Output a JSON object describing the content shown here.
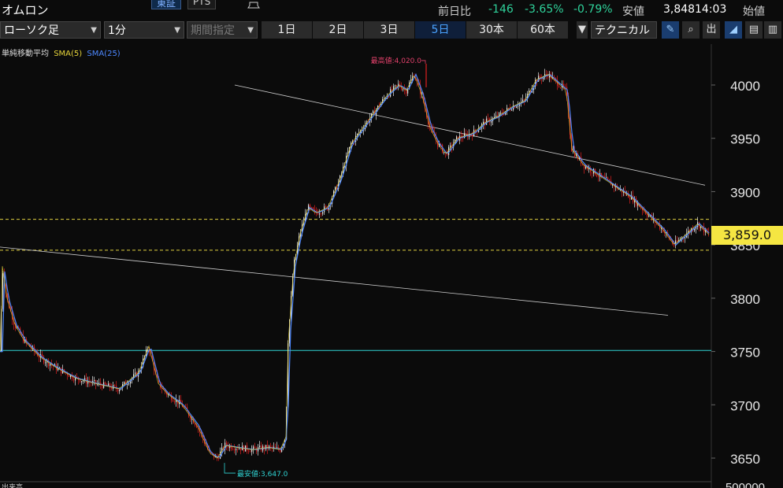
{
  "header": {
    "title": "オムロン",
    "exchange_tabs": [
      "東証",
      "PTS"
    ],
    "quote": {
      "prev_label": "前日比",
      "change": "-146",
      "change_pct": "-3.65%",
      "change_pct2": "-0.79%",
      "low_label": "安値",
      "low_value": "3,848",
      "time": "14:03",
      "open_label": "始値"
    }
  },
  "toolbar": {
    "chart_type": "ローソク足",
    "interval": "1分",
    "period": "期間指定",
    "timeframes": [
      "1日",
      "2日",
      "3日",
      "5日",
      "30本",
      "60本"
    ],
    "active_timeframe": "5日",
    "technical": "テクニカル"
  },
  "legend": {
    "title": "単純移動平均",
    "sma5": "SMA(5)",
    "sma25": "SMA(25)"
  },
  "chart_data": {
    "type": "line",
    "ylim": [
      3620,
      4060
    ],
    "y_ticks": [
      "4000",
      "3950",
      "3900",
      "3850",
      "3800",
      "3750",
      "3700",
      "3650"
    ],
    "last_price": "3,859.0",
    "high_label": "最高値:4,020.0",
    "low_label": "最安値:3,647.0",
    "volume_label": "500000",
    "vol_title": "出来高",
    "x": [
      0,
      2,
      8,
      18,
      30,
      50,
      70,
      95,
      120,
      150,
      175,
      188,
      200,
      212,
      230,
      250,
      265,
      275,
      285,
      300,
      320,
      340,
      355,
      362,
      365,
      372,
      380,
      390,
      400,
      415,
      430,
      445,
      460,
      475,
      490,
      505,
      515,
      525,
      535,
      545,
      555,
      565,
      580,
      600,
      615,
      630,
      650,
      665,
      680,
      695,
      710,
      718,
      725,
      740,
      760,
      780,
      800,
      820,
      840,
      855,
      870,
      885,
      900
    ],
    "values": [
      3750,
      3830,
      3800,
      3775,
      3760,
      3745,
      3735,
      3725,
      3720,
      3715,
      3730,
      3755,
      3720,
      3710,
      3700,
      3680,
      3655,
      3650,
      3662,
      3660,
      3658,
      3660,
      3658,
      3670,
      3760,
      3830,
      3860,
      3885,
      3880,
      3885,
      3910,
      3945,
      3960,
      3975,
      3990,
      4000,
      3995,
      4010,
      3990,
      3960,
      3945,
      3935,
      3950,
      3955,
      3965,
      3970,
      3980,
      3985,
      4005,
      4010,
      4000,
      3995,
      3940,
      3925,
      3915,
      3905,
      3895,
      3880,
      3865,
      3850,
      3860,
      3870,
      3859
    ],
    "high": {
      "x": 541,
      "value": 4020
    },
    "low": {
      "x": 285,
      "value": 3647
    },
    "hlines": [
      {
        "value": 3874,
        "color": "#e0d040",
        "style": "dash"
      },
      {
        "value": 3845,
        "color": "#e0d040",
        "style": "dash"
      },
      {
        "value": 3751,
        "color": "#2fd3d3",
        "style": "solid"
      }
    ],
    "trendlines": [
      {
        "x1": 298,
        "y1": 4000,
        "x2": 895,
        "y2": 3906
      },
      {
        "x1": 0,
        "y1": 3848,
        "x2": 848,
        "y2": 3784
      }
    ]
  },
  "colors": {
    "up": "#e8e8e8",
    "down": "#e02020",
    "sma5": "#e6d43a",
    "sma25": "#4d88ff",
    "neg": "#2fd39b",
    "accent": "#4aa3ff"
  }
}
